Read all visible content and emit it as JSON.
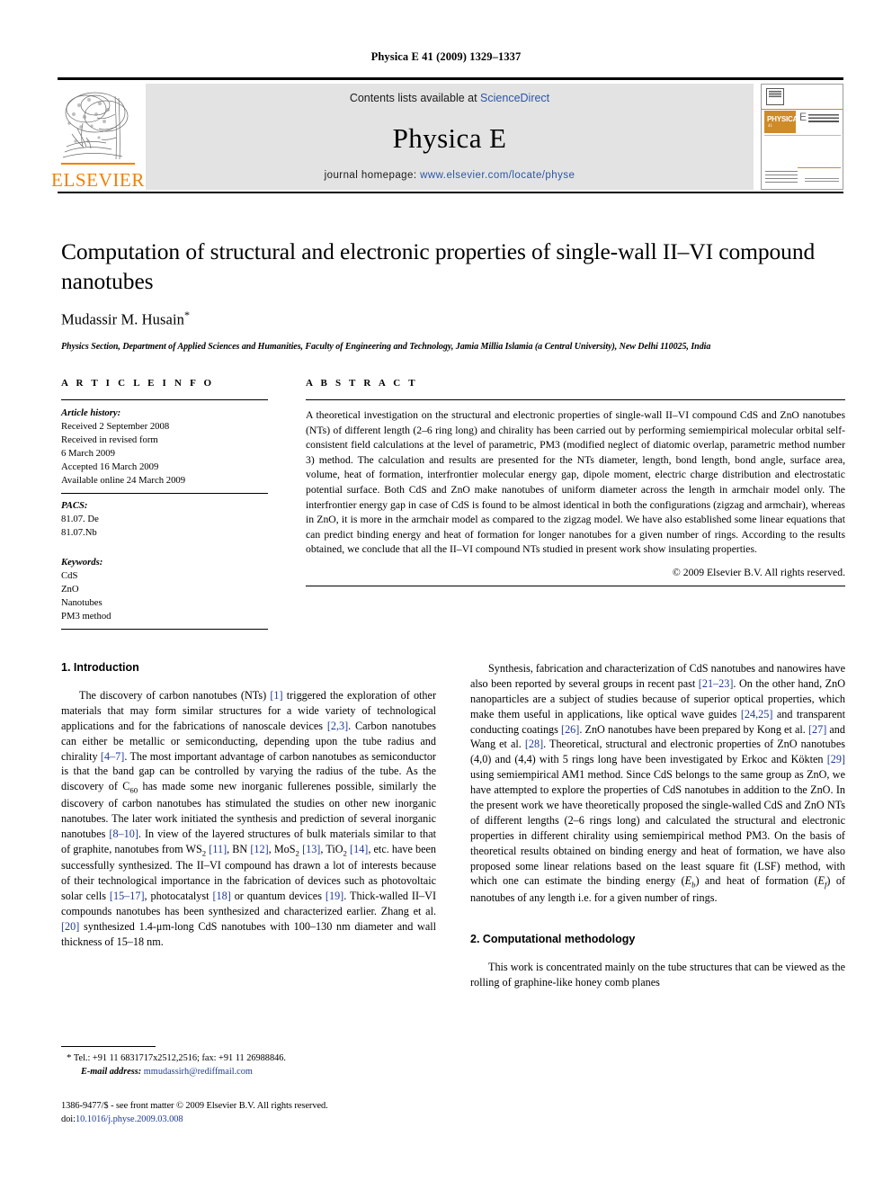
{
  "running_head": "Physica E 41 (2009) 1329–1337",
  "masthead": {
    "contents_prefix": "Contents lists available at ",
    "sciencedirect": "ScienceDirect",
    "journal_name": "Physica E",
    "homepage_prefix": "journal homepage: ",
    "homepage_url": "www.elsevier.com/locate/physe",
    "publisher_wordmark": "ELSEVIER",
    "cover": {
      "brand": "PHYSICA",
      "volume_letter": "E",
      "subtitle": "LOW-DIMENSIONAL SYSTEMS & NANOSTRUCTURES"
    },
    "link_color": "#2b55a8",
    "banner_bg": "#e3e3e3",
    "elsevier_orange": "#f08000"
  },
  "article": {
    "title": "Computation of structural and electronic properties of single-wall II–VI compound nanotubes",
    "author": "Mudassir M. Husain",
    "author_marker": "*",
    "affiliation": "Physics Section, Department of Applied Sciences and Humanities, Faculty of Engineering and Technology, Jamia Millia Islamia (a Central University), New Delhi 110025, India"
  },
  "article_info": {
    "heading": "A R T I C L E  I N F O",
    "history_label": "Article history:",
    "history": [
      "Received 2 September 2008",
      "Received in revised form",
      "6 March 2009",
      "Accepted 16 March 2009",
      "Available online 24 March 2009"
    ],
    "pacs_label": "PACS:",
    "pacs": [
      "81.07. De",
      "81.07.Nb"
    ],
    "keywords_label": "Keywords:",
    "keywords": [
      "CdS",
      "ZnO",
      "Nanotubes",
      "PM3 method"
    ]
  },
  "abstract": {
    "heading": "A B S T R A C T",
    "text": "A theoretical investigation on the structural and electronic properties of single-wall II–VI compound CdS and ZnO nanotubes (NTs) of different length (2–6 ring long) and chirality has been carried out by performing semiempirical molecular orbital self-consistent field calculations at the level of parametric, PM3 (modified neglect of diatomic overlap, parametric method number 3) method. The calculation and results are presented for the NTs diameter, length, bond length, bond angle, surface area, volume, heat of formation, interfrontier molecular energy gap, dipole moment, electric charge distribution and electrostatic potential surface. Both CdS and ZnO make nanotubes of uniform diameter across the length in armchair model only. The interfrontier energy gap in case of CdS is found to be almost identical in both the configurations (zigzag and armchair), whereas in ZnO, it is more in the armchair model as compared to the zigzag model. We have also established some linear equations that can predict binding energy and heat of formation for longer nanotubes for a given number of rings. According to the results obtained, we conclude that all the II–VI compound NTs studied in present work show insulating properties.",
    "copyright": "© 2009 Elsevier B.V. All rights reserved."
  },
  "sections": {
    "introduction_title": "1.  Introduction",
    "methodology_title": "2.  Computational methodology"
  },
  "body": {
    "left_p1_html": "The discovery of carbon nanotubes (NTs) <span class=\"ref\">[1]</span> triggered the exploration of other materials that may form similar structures for a wide variety of technological applications and for the fabrications of nanoscale devices <span class=\"ref\">[2,3]</span>. Carbon nanotubes can either be metallic or semiconducting, depending upon the tube radius and chirality <span class=\"ref\">[4–7]</span>. The most important advantage of carbon nanotubes as semiconductor is that the band gap can be controlled by varying the radius of the tube. As the discovery of C<sub>60</sub> has made some new inorganic fullerenes possible, similarly the discovery of carbon nanotubes has stimulated the studies on other new inorganic nanotubes. The later work initiated the synthesis and prediction of several inorganic nanotubes <span class=\"ref\">[8–10]</span>. In view of the layered structures of bulk materials similar to that of graphite, nanotubes from WS<sub>2</sub> <span class=\"ref\">[11]</span>, BN <span class=\"ref\">[12]</span>, MoS<sub>2</sub> <span class=\"ref\">[13]</span>, TiO<sub>2</sub> <span class=\"ref\">[14]</span>, etc. have been successfully synthesized. The II–VI compound has drawn a lot of interests because of their technological importance in the fabrication of devices such as photovoltaic solar cells <span class=\"ref\">[15–17]</span>, photocatalyst <span class=\"ref\">[18]</span> or quantum devices <span class=\"ref\">[19]</span>. Thick-walled II–VI compounds nanotubes has been synthesized and characterized earlier. Zhang et al. <span class=\"ref\">[20]</span> synthesized 1.4-μm-long CdS nanotubes with 100–130 nm diameter and wall thickness of 15–18 nm.",
    "right_p1_html": "Synthesis, fabrication and characterization of CdS nanotubes and nanowires have also been reported by several groups in recent past <span class=\"ref\">[21–23]</span>. On the other hand, ZnO nanoparticles are a subject of studies because of superior optical properties, which make them useful in applications, like optical wave guides <span class=\"ref\">[24,25]</span> and transparent conducting coatings <span class=\"ref\">[26]</span>. ZnO nanotubes have been prepared by Kong et al. <span class=\"ref\">[27]</span> and Wang et al. <span class=\"ref\">[28]</span>. Theoretical, structural and electronic properties of ZnO nanotubes (4,0) and (4,4) with 5 rings long have been investigated by Erkoc and Kökten <span class=\"ref\">[29]</span> using semiempirical AM1 method. Since CdS belongs to the same group as ZnO, we have attempted to explore the properties of CdS nanotubes in addition to the ZnO. In the present work we have theoretically proposed the single-walled CdS and ZnO NTs of different lengths (2–6 rings long) and calculated the structural and electronic properties in different chirality using semiempirical method PM3. On the basis of theoretical results obtained on binding energy and heat of formation, we have also proposed some linear relations based on the least square fit (LSF) method, with which one can estimate the binding energy (<i>E<sub>b</sub></i>) and heat of formation (<i>E<sub>f</sub></i>) of nanotubes of any length i.e. for a given number of rings.",
    "right_p2_html": "This work is concentrated mainly on the tube structures that can be viewed as the rolling of graphine-like honey comb planes"
  },
  "footnotes": {
    "tel_marker": "*",
    "tel": "Tel.: +91 11 6831717x2512,2516; fax: +91 11 26988846.",
    "email_label": "E-mail address:",
    "email": "mmudassirh@rediffmail.com"
  },
  "imprint": {
    "line1": "1386-9477/$ - see front matter © 2009 Elsevier B.V. All rights reserved.",
    "doi_label": "doi:",
    "doi": "10.1016/j.physe.2009.03.008"
  }
}
